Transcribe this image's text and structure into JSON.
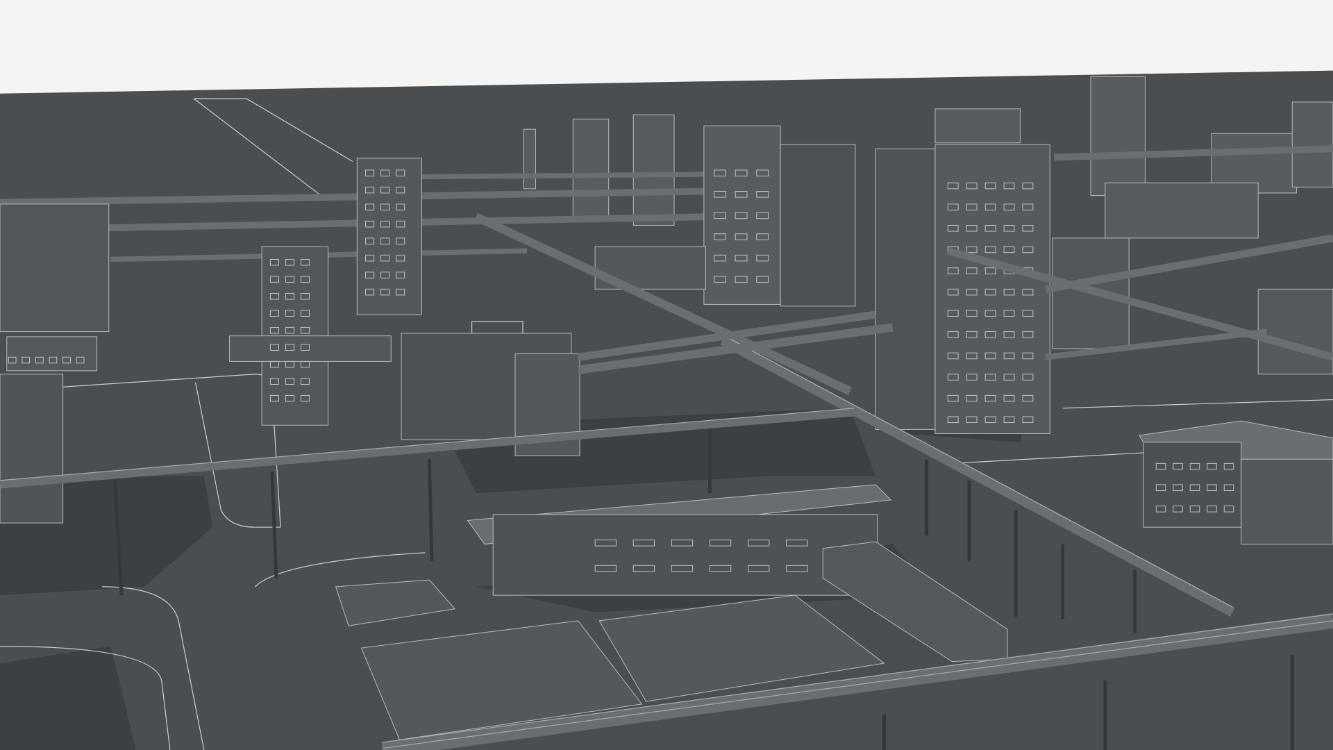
{
  "scene": {
    "colors": {
      "sky": "#f4f4f4",
      "ground": "#4b4e51",
      "shadow": "#3a3d40",
      "building": "#56595c",
      "building_dark": "#45484b",
      "outline": "#c2c6c9"
    }
  }
}
